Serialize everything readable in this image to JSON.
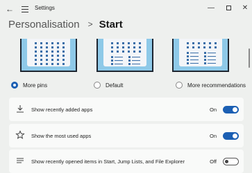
{
  "window": {
    "title": "Settings",
    "back_icon": "arrow-left-icon",
    "menu_icon": "hamburger-menu-icon",
    "minimize_glyph": "—",
    "close_glyph": "✕"
  },
  "breadcrumb": {
    "parent": "Personalisation",
    "separator": ">",
    "current": "Start"
  },
  "layouts": [
    {
      "label": "More pins",
      "selected": true
    },
    {
      "label": "Default",
      "selected": false
    },
    {
      "label": "More recommendations",
      "selected": false
    }
  ],
  "settings": [
    {
      "label": "Show recently added apps",
      "state": "On",
      "icon": "download-icon",
      "toggle_on": true
    },
    {
      "label": "Show the most used apps",
      "state": "On",
      "icon": "star-icon",
      "toggle_on": true
    },
    {
      "label": "Show recently opened items in Start, Jump Lists, and File Explorer",
      "state": "Off",
      "icon": "list-icon",
      "toggle_on": false
    }
  ],
  "colors": {
    "accent": "#1b5fb3",
    "background": "#eef0ee",
    "card": "#f9faf9",
    "preview_wallpaper": "#8ec9e8"
  }
}
